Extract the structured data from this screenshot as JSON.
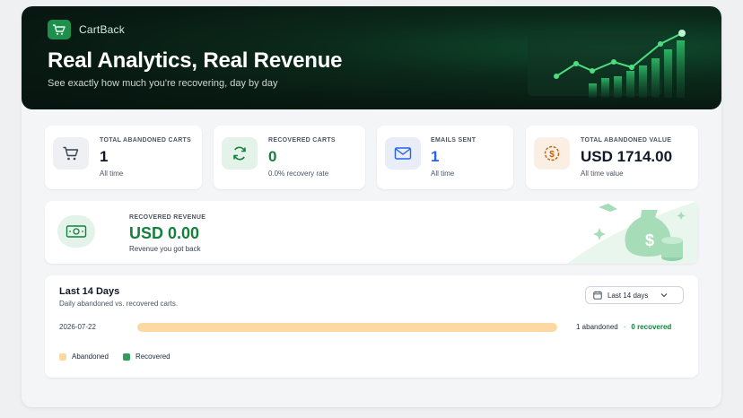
{
  "header": {
    "brand": "CartBack",
    "title": "Real Analytics, Real Revenue",
    "subtitle": "See exactly how much you're recovering, day by day"
  },
  "stats": [
    {
      "label": "TOTAL ABANDONED CARTS",
      "value": "1",
      "sub": "All time",
      "icon": "cart-icon"
    },
    {
      "label": "RECOVERED CARTS",
      "value": "0",
      "sub": "0.0% recovery rate",
      "icon": "refresh-icon"
    },
    {
      "label": "EMAILS SENT",
      "value": "1",
      "sub": "All time",
      "icon": "mail-icon"
    },
    {
      "label": "TOTAL ABANDONED VALUE",
      "value": "USD 1714.00",
      "sub": "All time value",
      "icon": "dollar-coin-icon"
    }
  ],
  "revenue": {
    "label": "RECOVERED REVENUE",
    "value": "USD 0.00",
    "sub": "Revenue you got back",
    "icon": "cash-icon"
  },
  "days": {
    "title": "Last 14 Days",
    "subtitle": "Daily abandoned vs. recovered carts.",
    "range_label": "Last 14 days",
    "rows": [
      {
        "date": "2026-07-22",
        "abandoned_text": "1 abandoned",
        "separator": "·",
        "recovered_text": "0 recovered",
        "abandoned_fraction": 1.0
      }
    ],
    "legend": {
      "abandoned": "Abandoned",
      "recovered": "Recovered"
    }
  },
  "colors": {
    "accent": "#15803d",
    "abandoned_bar": "#fcd9a2",
    "recovered_swatch": "#2f9e5a",
    "emails_value": "#2563eb"
  }
}
